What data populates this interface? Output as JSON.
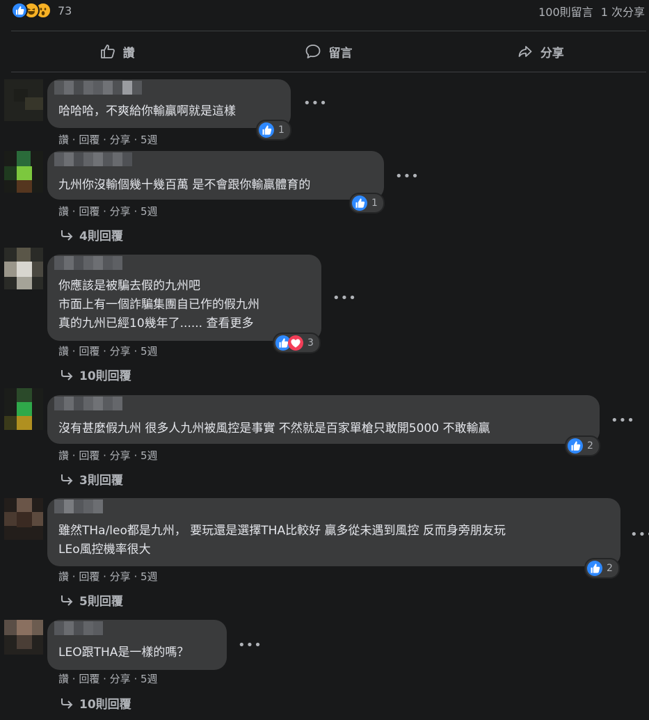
{
  "stats": {
    "reaction_count": "73",
    "comments": "100則留言",
    "shares": "1 次分享"
  },
  "actions": {
    "like": "讚",
    "comment": "留言",
    "share": "分享"
  },
  "meta": {
    "like": "讚",
    "sep": " · ",
    "reply": "回覆",
    "share": "分享",
    "time": "5週"
  },
  "comments": [
    {
      "text": "哈哈哈，不爽給你輸贏啊就是這樣",
      "reactions": "1",
      "replies": ""
    },
    {
      "text": "九州你沒輸個幾十幾百萬 是不會跟你輸贏體育的",
      "reactions": "1",
      "replies": "4則回覆"
    },
    {
      "text": "你應該是被騙去假的九州吧\n市面上有一個詐騙集團自已作的假九州\n真的九州已經10幾年了...... 查看更多",
      "reactions": "3",
      "replies": "10則回覆"
    },
    {
      "text": "沒有甚麼假九州 很多人九州被風控是事實 不然就是百家單槍只敢開5000 不敢輸贏",
      "reactions": "2",
      "replies": "3則回覆"
    },
    {
      "text": "雖然THa/leo都是九州， 要玩還是選擇THA比較好 贏多從未遇到風控 反而身旁朋友玩\nLEo風控機率很大",
      "reactions": "2",
      "replies": "5則回覆"
    },
    {
      "text": "LEO跟THA是一樣的嗎？",
      "reactions": "",
      "replies": "10則回覆"
    }
  ]
}
